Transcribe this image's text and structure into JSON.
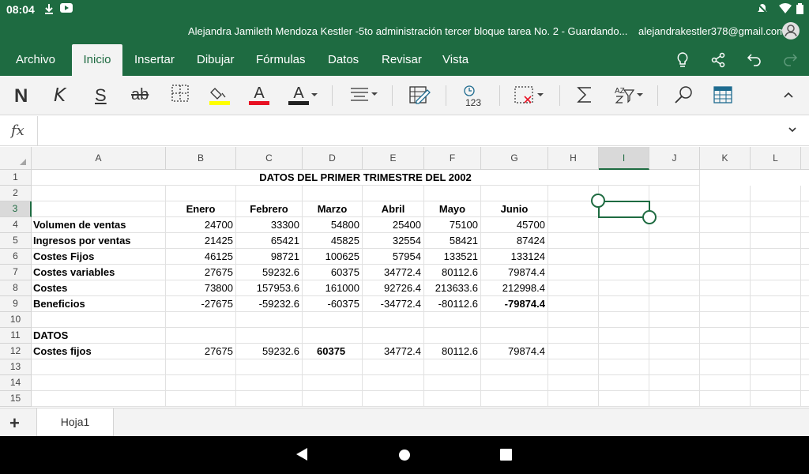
{
  "status": {
    "time": "08:04"
  },
  "title": {
    "document": "Alejandra Jamileth Mendoza Kestler -5to administración tercer bloque tarea No. 2 - Guardando...",
    "account": "alejandrakestler378@gmail.com"
  },
  "tabs": [
    "Archivo",
    "Inicio",
    "Insertar",
    "Dibujar",
    "Fórmulas",
    "Datos",
    "Revisar",
    "Vista"
  ],
  "toolbar": {
    "bold": "N",
    "italic": "K",
    "underline": "S",
    "strike": "ab",
    "number_format": "123"
  },
  "formula": {
    "label": "fx",
    "value": ""
  },
  "columns": [
    "A",
    "B",
    "C",
    "D",
    "E",
    "F",
    "G",
    "H",
    "I",
    "J",
    "K",
    "L"
  ],
  "rows": [
    "1",
    "2",
    "3",
    "4",
    "5",
    "6",
    "7",
    "8",
    "9",
    "10",
    "11",
    "12",
    "13",
    "14",
    "15"
  ],
  "sheet": {
    "title": "DATOS DEL PRIMER TRIMESTRE DEL 2002",
    "months": [
      "Enero",
      "Febrero",
      "Marzo",
      "Abril",
      "Mayo",
      "Junio"
    ],
    "data_rows": [
      {
        "label": "Volumen de ventas",
        "values": [
          "24700",
          "33300",
          "54800",
          "25400",
          "75100",
          "45700"
        ]
      },
      {
        "label": "Ingresos por ventas",
        "values": [
          "21425",
          "65421",
          "45825",
          "32554",
          "58421",
          "87424"
        ]
      },
      {
        "label": "Costes Fijos",
        "values": [
          "46125",
          "98721",
          "100625",
          "57954",
          "133521",
          "133124"
        ]
      },
      {
        "label": "Costes variables",
        "values": [
          "27675",
          "59232.6",
          "60375",
          "34772.4",
          "80112.6",
          "79874.4"
        ]
      },
      {
        "label": "Costes",
        "values": [
          "73800",
          "157953.6",
          "161000",
          "92726.4",
          "213633.6",
          "212998.4"
        ]
      },
      {
        "label": "Beneficios",
        "values": [
          "-27675",
          "-59232.6",
          "-60375",
          "-34772.4",
          "-80112.6",
          "-79874.4"
        ]
      }
    ],
    "datos_label": "DATOS",
    "costes_fijos_row": {
      "label": "Costes fijos",
      "values": [
        "27675",
        "59232.6",
        "60375",
        "34772.4",
        "80112.6",
        "79874.4"
      ]
    }
  },
  "sheet_tabs": {
    "add": "+",
    "active": "Hoja1"
  },
  "colors": {
    "brand": "#1e6b41",
    "ribbon": "#f3f3f3"
  }
}
